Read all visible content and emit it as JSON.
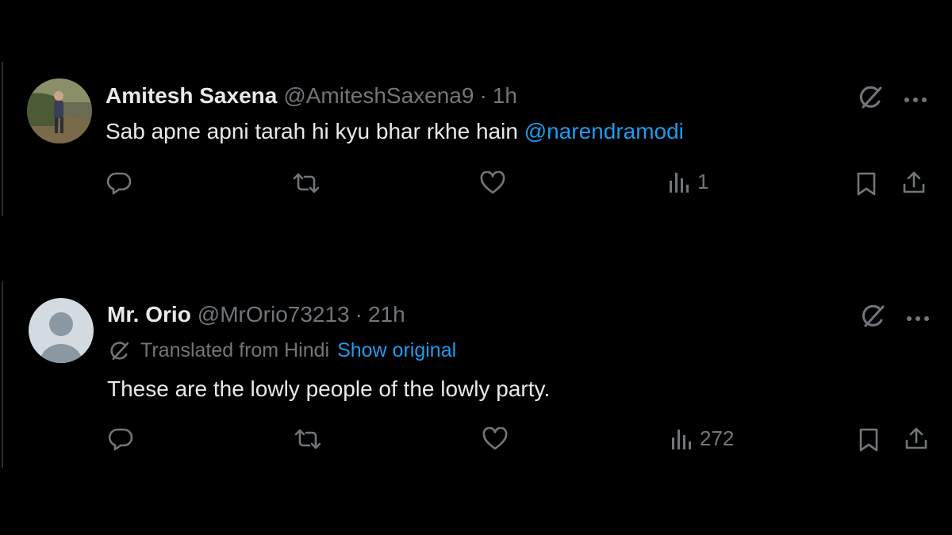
{
  "tweets": [
    {
      "name": "Amitesh Saxena",
      "handle": "@AmiteshSaxena9",
      "separator": "·",
      "time": "1h",
      "text": "Sab apne apni tarah hi kyu bhar rkhe hain ",
      "mention": "@narendramodi",
      "views": "1",
      "avatar": "photo-avatar"
    },
    {
      "name": "Mr. Orio",
      "handle": "@MrOrio73213",
      "separator": "·",
      "time": "21h",
      "translated_label": "Translated from Hindi",
      "show_original": "Show original",
      "text": "These are the lowly people of the lowly party.",
      "views": "272",
      "avatar": "default-avatar"
    }
  ],
  "icons": [
    "grok-icon",
    "more-icon",
    "reply-icon",
    "retweet-icon",
    "like-icon",
    "views-icon",
    "bookmark-icon",
    "share-icon",
    "translate-icon"
  ],
  "colors": {
    "background": "#000000",
    "text": "#e7e9ea",
    "muted": "#71767b",
    "link": "#1d9bf0"
  }
}
